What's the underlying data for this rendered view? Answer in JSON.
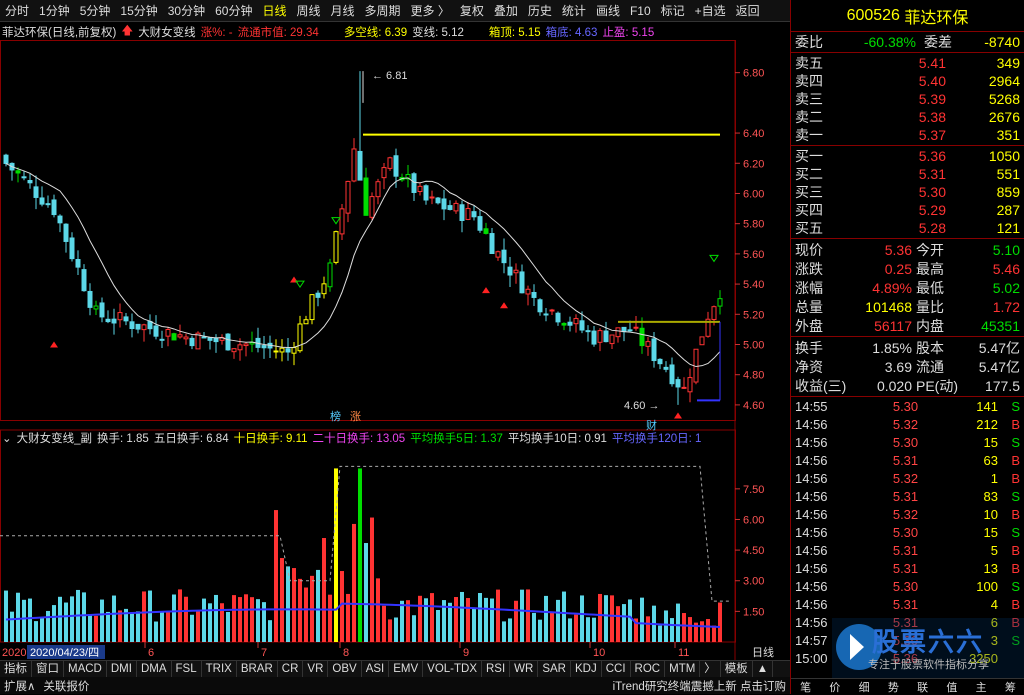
{
  "toolbar": {
    "items": [
      "分时",
      "1分钟",
      "5分钟",
      "15分钟",
      "30分钟",
      "60分钟",
      "日线",
      "周线",
      "月线",
      "多周期",
      "更多 〉",
      "复权",
      "叠加",
      "历史",
      "统计",
      "画线",
      "F10",
      "标记",
      "+自选",
      "返回"
    ],
    "active": "日线"
  },
  "main_legend": {
    "name": "菲达环保(日线,前复权)",
    "indicator": "大财女变线",
    "rise": "涨%: -",
    "cap": "流通市值: 29.34",
    "duo": "多空线: 6.39",
    "bian": "变线: 5.12",
    "top": "箱顶: 5.15",
    "bottom": "箱底: 4.63",
    "stop": "止盈: 5.15"
  },
  "sub_legend": {
    "name": "大财女变线_副",
    "h": "换手: 1.85",
    "h5": "五日换手: 6.84",
    "h10": "十日换手: 9.11",
    "h20": "二十日换手: 13.05",
    "a5": "平均换手5日: 1.37",
    "a10": "平均换手10日: 0.91",
    "a120": "平均换手120日: 1"
  },
  "axis": {
    "price_ticks": [
      "6.80",
      "6.40",
      "6.20",
      "6.00",
      "5.80",
      "5.60",
      "5.40",
      "5.20",
      "5.00",
      "4.80",
      "4.60"
    ],
    "vol_ticks": [
      "7.50",
      "6.00",
      "4.50",
      "3.00",
      "1.50"
    ],
    "months": [
      "6",
      "7",
      "8",
      "9",
      "10",
      "11"
    ],
    "date_label": "2020/04/23/四",
    "year_label": "2020",
    "day_label": "日线"
  },
  "annotations": {
    "high": "6.81",
    "low": "4.60",
    "bang": "榜",
    "zhang": "涨",
    "cai": "财"
  },
  "tabs": [
    "指标",
    "窗口",
    "MACD",
    "DMI",
    "DMA",
    "FSL",
    "TRIX",
    "BRAR",
    "CR",
    "VR",
    "OBV",
    "ASI",
    "EMV",
    "VOL-TDX",
    "RSI",
    "WR",
    "SAR",
    "KDJ",
    "CCI",
    "ROC",
    "MTM",
    "〉",
    "模板",
    "▲"
  ],
  "bottom": {
    "expand": "扩展∧",
    "related": "关联报价",
    "ad": "iTrend研究终端震撼上新 点击订购"
  },
  "quote": {
    "code": "600526",
    "name": "菲达环保",
    "weibi_label": "委比",
    "weibi": "-60.38%",
    "weicha_label": "委差",
    "weicha": "-8740",
    "sells": [
      {
        "l": "卖五",
        "p": "5.41",
        "v": "349"
      },
      {
        "l": "卖四",
        "p": "5.40",
        "v": "2964"
      },
      {
        "l": "卖三",
        "p": "5.39",
        "v": "5268"
      },
      {
        "l": "卖二",
        "p": "5.38",
        "v": "2676"
      },
      {
        "l": "卖一",
        "p": "5.37",
        "v": "351"
      }
    ],
    "buys": [
      {
        "l": "买一",
        "p": "5.36",
        "v": "1050"
      },
      {
        "l": "买二",
        "p": "5.31",
        "v": "551"
      },
      {
        "l": "买三",
        "p": "5.30",
        "v": "859"
      },
      {
        "l": "买四",
        "p": "5.29",
        "v": "287"
      },
      {
        "l": "买五",
        "p": "5.28",
        "v": "121"
      }
    ],
    "stats1": [
      {
        "l": "现价",
        "a": "5.36",
        "l2": "今开",
        "b": "5.10"
      },
      {
        "l": "涨跌",
        "a": "0.25",
        "l2": "最高",
        "b": "5.46"
      },
      {
        "l": "涨幅",
        "a": "4.89%",
        "l2": "最低",
        "b": "5.02"
      },
      {
        "l": "总量",
        "a": "101468",
        "l2": "量比",
        "b": "1.72"
      },
      {
        "l": "外盘",
        "a": "56117",
        "l2": "内盘",
        "b": "45351"
      }
    ],
    "stats2": [
      {
        "l": "换手",
        "a": "1.85%",
        "l2": "股本",
        "b": "5.47亿"
      },
      {
        "l": "净资",
        "a": "3.69",
        "l2": "流通",
        "b": "5.47亿"
      },
      {
        "l": "收益(三)",
        "a": "0.020",
        "l2": "PE(动)",
        "b": "177.5"
      }
    ],
    "ticks": [
      {
        "t": "14:55",
        "p": "5.30",
        "q": "141",
        "s": "S"
      },
      {
        "t": "14:56",
        "p": "5.32",
        "q": "212",
        "s": "B"
      },
      {
        "t": "14:56",
        "p": "5.30",
        "q": "15",
        "s": "S"
      },
      {
        "t": "14:56",
        "p": "5.31",
        "q": "63",
        "s": "B"
      },
      {
        "t": "14:56",
        "p": "5.32",
        "q": "1",
        "s": "B"
      },
      {
        "t": "14:56",
        "p": "5.31",
        "q": "83",
        "s": "S"
      },
      {
        "t": "14:56",
        "p": "5.32",
        "q": "10",
        "s": "B"
      },
      {
        "t": "14:56",
        "p": "5.30",
        "q": "15",
        "s": "S"
      },
      {
        "t": "14:56",
        "p": "5.31",
        "q": "5",
        "s": "B"
      },
      {
        "t": "14:56",
        "p": "5.31",
        "q": "13",
        "s": "B"
      },
      {
        "t": "14:56",
        "p": "5.30",
        "q": "100",
        "s": "S"
      },
      {
        "t": "14:56",
        "p": "5.31",
        "q": "4",
        "s": "B"
      },
      {
        "t": "14:56",
        "p": "5.31",
        "q": "6",
        "s": "B"
      },
      {
        "t": "14:57",
        "p": "5.30",
        "q": "3",
        "s": "S"
      },
      {
        "t": "15:00",
        "p": "5.36",
        "q": "3250",
        "s": ""
      }
    ],
    "foot": [
      "笔",
      "价",
      "细",
      "势",
      "联",
      "值",
      "主",
      "筹"
    ]
  },
  "watermark": {
    "big": "股票六六",
    "small": "专注于股票软件指标分享"
  },
  "colors": {
    "up": "#ff3333",
    "down": "#00dd00",
    "ma": "#ffffff",
    "box": "#ffff00",
    "bg": "#000000"
  }
}
